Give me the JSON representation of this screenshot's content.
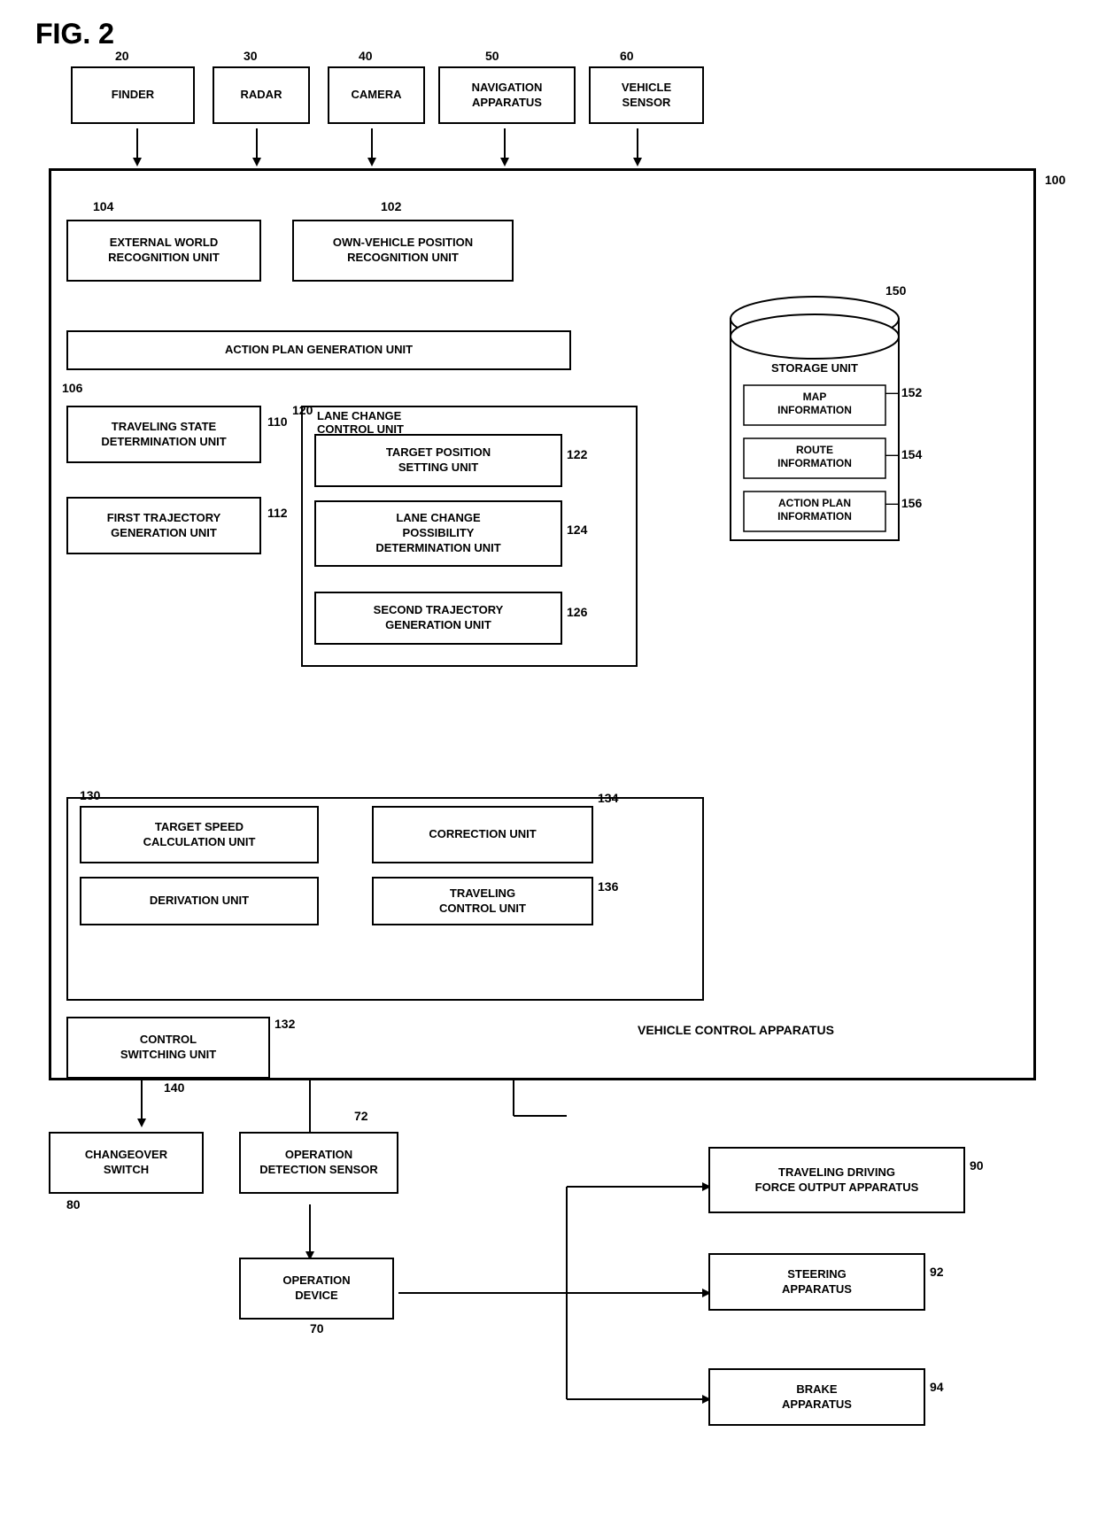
{
  "fig_label": "FIG. 2",
  "components": {
    "finder": {
      "label": "FINDER",
      "ref": "20"
    },
    "radar": {
      "label": "RADAR",
      "ref": "30"
    },
    "camera": {
      "label": "CAMERA",
      "ref": "40"
    },
    "navigation": {
      "label": "NAVIGATION\nAPPARATUS",
      "ref": "50"
    },
    "vehicle_sensor": {
      "label": "VEHICLE\nSENSOR",
      "ref": "60"
    },
    "external_world": {
      "label": "EXTERNAL WORLD\nRECOGNITION UNIT",
      "ref": "104"
    },
    "own_vehicle": {
      "label": "OWN-VEHICLE POSITION\nRECOGNITION UNIT",
      "ref": "102"
    },
    "action_plan": {
      "label": "ACTION PLAN GENERATION UNIT",
      "ref": ""
    },
    "traveling_state": {
      "label": "TRAVELING STATE\nDETERMINATION UNIT",
      "ref": "110"
    },
    "first_trajectory": {
      "label": "FIRST TRAJECTORY\nGENERATION UNIT",
      "ref": "112"
    },
    "lane_change_control": {
      "label": "LANE CHANGE\nCONTROL UNIT",
      "ref": "120"
    },
    "target_position": {
      "label": "TARGET POSITION\nSETTING UNIT",
      "ref": "122"
    },
    "lane_change_possibility": {
      "label": "LANE CHANGE\nPOSSIBILITY\nDETERMINATION UNIT",
      "ref": "124"
    },
    "second_trajectory": {
      "label": "SECOND TRAJECTORY\nGENERATION UNIT",
      "ref": "126"
    },
    "target_speed_calc": {
      "label": "TARGET SPEED\nCALCULATION UNIT",
      "ref": "130"
    },
    "derivation": {
      "label": "DERIVATION UNIT",
      "ref": ""
    },
    "correction": {
      "label": "CORRECTION UNIT",
      "ref": "134"
    },
    "traveling_control": {
      "label": "TRAVELING\nCONTROL UNIT",
      "ref": "136"
    },
    "control_switching": {
      "label": "CONTROL\nSWITCHING UNIT",
      "ref": "140"
    },
    "changeover_switch": {
      "label": "CHANGEOVER\nSWITCH",
      "ref": "80"
    },
    "operation_detection": {
      "label": "OPERATION\nDETECTION SENSOR",
      "ref": "72"
    },
    "operation_device": {
      "label": "OPERATION\nDEVICE",
      "ref": "70"
    },
    "traveling_driving": {
      "label": "TRAVELING DRIVING\nFORCE OUTPUT APPARATUS",
      "ref": "90"
    },
    "steering": {
      "label": "STEERING\nAPPARATUS",
      "ref": "92"
    },
    "brake": {
      "label": "BRAKE\nAPPARATUS",
      "ref": "94"
    },
    "storage": {
      "label": "STORAGE UNIT",
      "ref": "150"
    },
    "map_info": {
      "label": "MAP\nINFORMATION",
      "ref": "152"
    },
    "route_info": {
      "label": "ROUTE\nINFORMATION",
      "ref": "154"
    },
    "action_plan_info": {
      "label": "ACTION PLAN\nINFORMATION",
      "ref": "156"
    },
    "vehicle_control_apparatus": {
      "label": "VEHICLE CONTROL APPARATUS",
      "ref": "100"
    }
  }
}
